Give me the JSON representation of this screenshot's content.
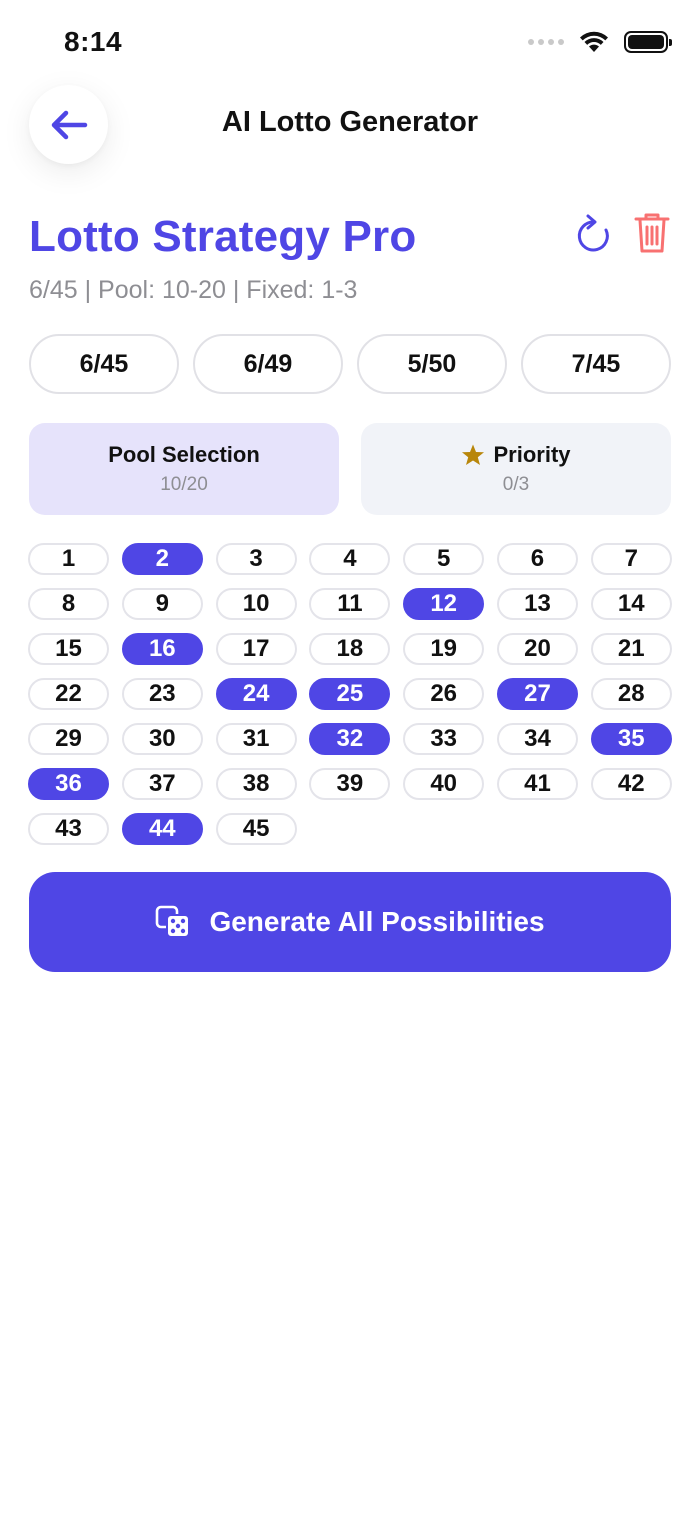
{
  "status_bar": {
    "time": "8:14"
  },
  "header": {
    "title": "AI Lotto Generator"
  },
  "strategy": {
    "title": "Lotto Strategy Pro",
    "subtitle": "6/45 | Pool: 10-20 | Fixed: 1-3"
  },
  "formats": [
    "6/45",
    "6/49",
    "5/50",
    "7/45"
  ],
  "modes": [
    {
      "label": "Pool Selection",
      "count": "10/20",
      "active": true
    },
    {
      "label": "Priority",
      "count": "0/3",
      "active": false
    }
  ],
  "numbers": [
    "1",
    "2",
    "3",
    "4",
    "5",
    "6",
    "7",
    "8",
    "9",
    "10",
    "11",
    "12",
    "13",
    "14",
    "15",
    "16",
    "17",
    "18",
    "19",
    "20",
    "21",
    "22",
    "23",
    "24",
    "25",
    "26",
    "27",
    "28",
    "29",
    "30",
    "31",
    "32",
    "33",
    "34",
    "35",
    "36",
    "37",
    "38",
    "39",
    "40",
    "41",
    "42",
    "43",
    "44",
    "45"
  ],
  "selected_numbers": [
    "2",
    "12",
    "16",
    "24",
    "25",
    "27",
    "32",
    "35",
    "36",
    "44"
  ],
  "generate_button": {
    "label": "Generate All Possibilities"
  },
  "colors": {
    "accent": "#4f46e5",
    "delete": "#f87171",
    "star": "#b8860b",
    "pool_tab": "#e6e3fb",
    "tab": "#f1f3f8"
  }
}
